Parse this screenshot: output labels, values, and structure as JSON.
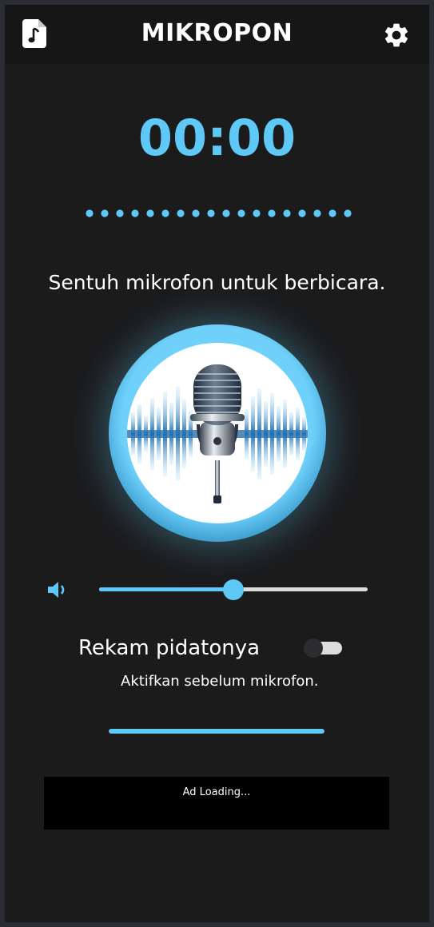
{
  "appbar": {
    "title": "MIKROPON",
    "left_icon": "audio-file-icon",
    "right_icon": "gear-icon"
  },
  "timer": "00:00",
  "prompt": "Sentuh mikrofon untuk berbicara.",
  "mic_button": {
    "icon": "microphone-image"
  },
  "volume": {
    "icon": "speaker-icon",
    "level": 0.5
  },
  "record": {
    "label": "Rekam pidatonya",
    "enabled": false,
    "help": "Aktifkan sebelum mikrofon."
  },
  "progress": {
    "value": 1.0
  },
  "ad": {
    "text": "Ad Loading..."
  },
  "colors": {
    "accent": "#5ec8f6",
    "background": "#1b1b1c",
    "appbar": "#161617",
    "text": "#ffffff"
  }
}
